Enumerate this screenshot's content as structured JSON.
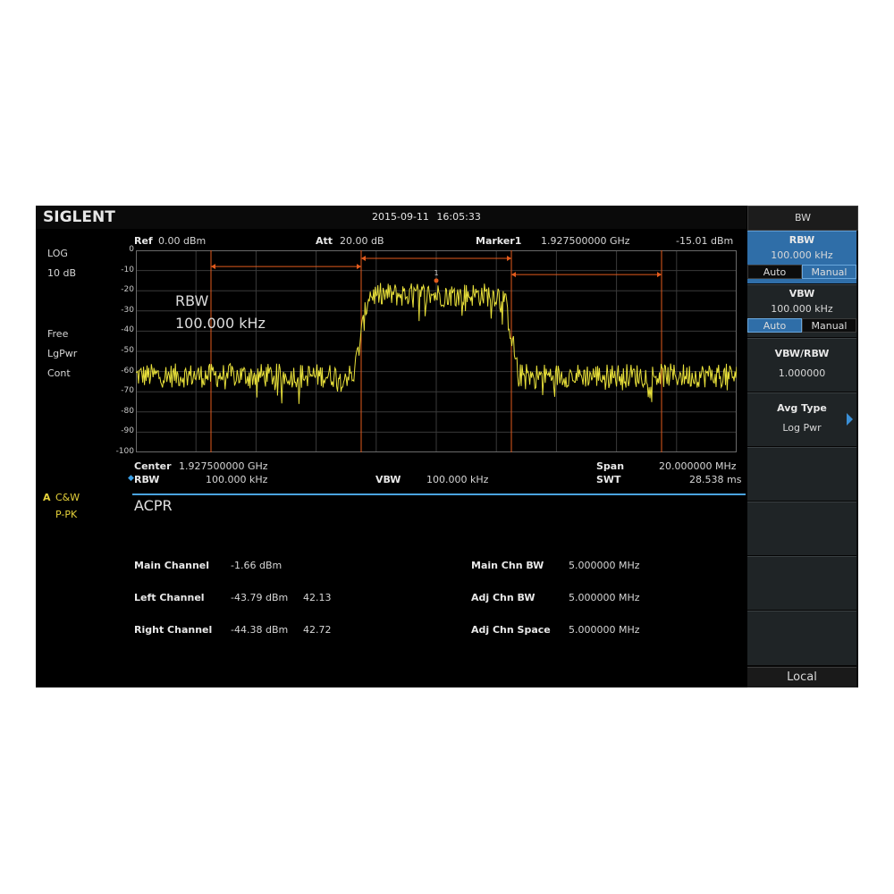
{
  "header": {
    "logo": "SIGLENT",
    "datetime": "2015-09-11  16:05:33"
  },
  "left_panel": {
    "scale_type": "LOG",
    "scale_div": "10 dB",
    "trig": "Free",
    "avg": "LgPwr",
    "sweep": "Cont",
    "trace_id": "A",
    "trace_mode": "C&W",
    "detector": "P-PK"
  },
  "plot_header": {
    "ref_label": "Ref",
    "ref_value": "0.00 dBm",
    "att_label": "Att",
    "att_value": "20.00 dB",
    "marker_label": "Marker1",
    "marker_freq": "1.927500000  GHz",
    "marker_level": "-15.01 dBm"
  },
  "overlay": {
    "line1": "RBW",
    "line2": "100.000  kHz"
  },
  "plot_footer": {
    "center_label": "Center",
    "center_value": "1.927500000  GHz",
    "span_label": "Span",
    "span_value": "20.000000  MHz",
    "rbw_label": "RBW",
    "rbw_value": "100.000  kHz",
    "vbw_label": "VBW",
    "vbw_value": "100.000  kHz",
    "swt_label": "SWT",
    "swt_value": "28.538 ms"
  },
  "acpr": {
    "title": "ACPR",
    "rows": [
      {
        "label": "Main Channel",
        "value": "-1.66 dBm",
        "extra": ""
      },
      {
        "label": "Left Channel",
        "value": "-43.79 dBm",
        "extra": "42.13"
      },
      {
        "label": "Right Channel",
        "value": "-44.38 dBm",
        "extra": "42.72"
      }
    ],
    "settings": [
      {
        "label": "Main Chn BW",
        "value": "5.000000  MHz"
      },
      {
        "label": "Adj Chn BW",
        "value": "5.000000  MHz"
      },
      {
        "label": "Adj Chn Space",
        "value": "5.000000  MHz"
      }
    ]
  },
  "menu": {
    "title": "BW",
    "rbw": {
      "label": "RBW",
      "value": "100.000  kHz",
      "opt_auto": "Auto",
      "opt_manual": "Manual",
      "selected": "Manual"
    },
    "vbw": {
      "label": "VBW",
      "value": "100.000  kHz",
      "opt_auto": "Auto",
      "opt_manual": "Manual",
      "selected": "Auto"
    },
    "vbw_rbw": {
      "label": "VBW/RBW",
      "value": "1.000000"
    },
    "avg_type": {
      "label": "Avg Type",
      "value": "Log Pwr"
    },
    "local": "Local"
  },
  "chart_data": {
    "type": "line",
    "title": "",
    "xlabel": "",
    "ylabel": "",
    "y_ticks": [
      "0",
      "-10",
      "-20",
      "-30",
      "-40",
      "-50",
      "-60",
      "-70",
      "-80",
      "-90",
      "-100"
    ],
    "ylim": [
      -100,
      0
    ],
    "xlim_mhz": [
      1917.5,
      1937.5
    ],
    "grid": true,
    "x_divisions": 10,
    "series": [
      {
        "color": "#e8e03a",
        "shape": "channel power trace",
        "segments": [
          {
            "x_start_mhz": 1917.5,
            "x_end_mhz": 1925.0,
            "level_dbm": -62
          },
          {
            "x_start_mhz": 1925.0,
            "x_end_mhz": 1930.0,
            "level_dbm": -22
          },
          {
            "x_start_mhz": 1930.0,
            "x_end_mhz": 1937.5,
            "level_dbm": -62
          }
        ]
      }
    ],
    "channel_lines_mhz": [
      1920.0,
      1925.0,
      1930.0,
      1935.0
    ],
    "channel_bars": [
      {
        "name": "left",
        "from_mhz": 1920.0,
        "to_mhz": 1925.0,
        "level_db": -8
      },
      {
        "name": "main",
        "from_mhz": 1925.0,
        "to_mhz": 1930.0,
        "level_db": -4
      },
      {
        "name": "right",
        "from_mhz": 1930.0,
        "to_mhz": 1935.0,
        "level_db": -12
      }
    ],
    "marker": {
      "label": "1",
      "x_mhz": 1927.5,
      "y_dbm": -15.01
    },
    "colors": {
      "trace": "#e8e03a",
      "channel": "#e25a1c",
      "marker": "#e25a1c",
      "grid": "#3a3a3a",
      "border": "#6a6a6a"
    }
  }
}
